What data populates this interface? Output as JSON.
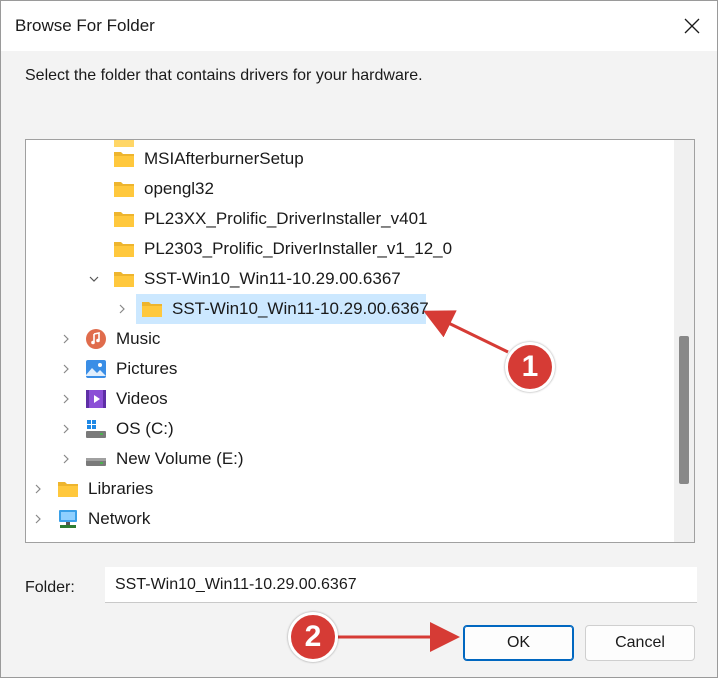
{
  "window": {
    "title": "Browse For Folder",
    "close_icon": "close-icon"
  },
  "instruction": "Select the folder that contains drivers for your hardware.",
  "tree": {
    "items": [
      {
        "label": "MSIAfterburnerSetup",
        "icon": "folder-icon"
      },
      {
        "label": "opengl32",
        "icon": "folder-icon"
      },
      {
        "label": "PL23XX_Prolific_DriverInstaller_v401",
        "icon": "folder-icon"
      },
      {
        "label": "PL2303_Prolific_DriverInstaller_v1_12_0",
        "icon": "folder-icon"
      },
      {
        "label": "SST-Win10_Win11-10.29.00.6367",
        "icon": "folder-icon",
        "expanded": true
      },
      {
        "label": "SST-Win10_Win11-10.29.00.6367",
        "icon": "folder-icon",
        "selected": true
      },
      {
        "label": "Music",
        "icon": "music-icon"
      },
      {
        "label": "Pictures",
        "icon": "pictures-icon"
      },
      {
        "label": "Videos",
        "icon": "videos-icon"
      },
      {
        "label": "OS (C:)",
        "icon": "drive-icon"
      },
      {
        "label": "New Volume (E:)",
        "icon": "drive-icon"
      },
      {
        "label": "Libraries",
        "icon": "libraries-icon"
      },
      {
        "label": "Network",
        "icon": "network-icon"
      }
    ]
  },
  "folder": {
    "label": "Folder:",
    "value": "SST-Win10_Win11-10.29.00.6367"
  },
  "buttons": {
    "ok": "OK",
    "cancel": "Cancel"
  },
  "annotations": {
    "one": "1",
    "two": "2"
  },
  "colors": {
    "accent": "#0067c0",
    "selection": "#cce8ff",
    "annotation_red": "#d63b35",
    "folder_yellow": "#ffc83d"
  }
}
